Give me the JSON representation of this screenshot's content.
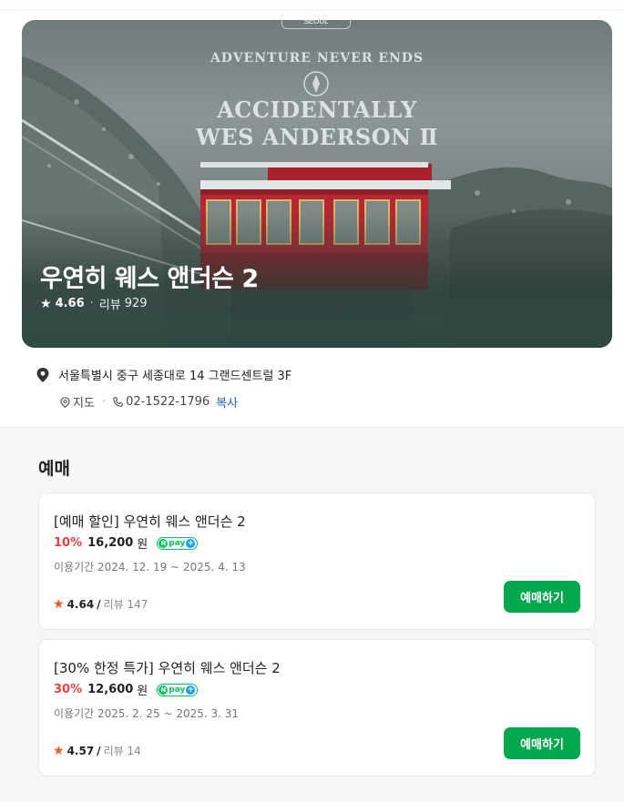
{
  "hero": {
    "title": "우연히 웨스 앤더슨 2",
    "rating": "4.66",
    "review_label": "리뷰",
    "review_count": "929",
    "poster": {
      "badge": "SEOUL",
      "arc_text": "ADVENTURE NEVER ENDS",
      "title_line1": "ACCIDENTALLY",
      "title_line2": "WES ANDERSON Ⅱ"
    }
  },
  "info": {
    "address": "서울특별시 중구 세종대로 14 그랜드센트럴 3F",
    "map_label": "지도",
    "phone": "02-1522-1796",
    "copy_label": "복사"
  },
  "booking": {
    "section_title": "예매",
    "items": [
      {
        "name": "[예매 할인] 우연히 웨스 앤더슨 2",
        "discount": "10%",
        "price": "16,200",
        "currency": "원",
        "period": "이용기간 2024. 12. 19 ~ 2025. 4. 13",
        "rating": "4.64",
        "review_text": "리뷰 147",
        "button_label": "예매하기"
      },
      {
        "name": "[30% 한정 특가] 우연히 웨스 앤더슨 2",
        "discount": "30%",
        "price": "12,600",
        "currency": "원",
        "period": "이용기간 2025. 2. 25 ~ 2025. 3. 31",
        "rating": "4.57",
        "review_text": "리뷰 14",
        "button_label": "예매하기"
      }
    ],
    "npay_label": "pay"
  },
  "colors": {
    "accent_green": "#03a84e",
    "discount_red": "#ee3f3f",
    "star_orange": "#f05a28",
    "link_blue": "#1b63c6"
  }
}
